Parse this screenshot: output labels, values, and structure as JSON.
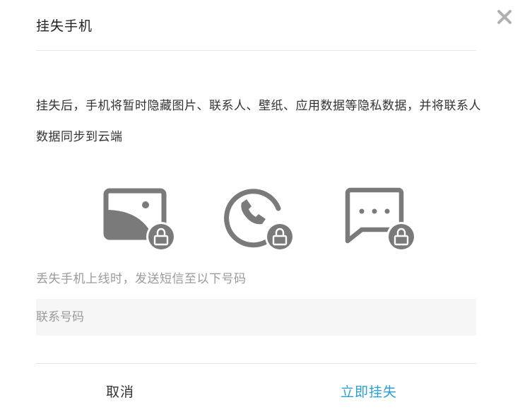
{
  "dialog": {
    "title": "挂失手机",
    "description": "挂失后，手机将暂时隐藏图片、联系人、壁纸、应用数据等隐私数据，并将联系人数据同步到云端",
    "features": [
      {
        "icon": "locked-gallery-icon"
      },
      {
        "icon": "locked-phone-call-icon"
      },
      {
        "icon": "locked-message-icon"
      }
    ],
    "hint": "丢失手机上线时，发送短信至以下号码",
    "contact_field": {
      "placeholder": "联系号码",
      "value": ""
    },
    "cancel_label": "取消",
    "confirm_label": "立即挂失"
  },
  "colors": {
    "accent": "#2a9fd6",
    "icon_gray": "#7a7a7a",
    "divider": "#e6e6e6",
    "field_bg": "#f6f6f6"
  }
}
